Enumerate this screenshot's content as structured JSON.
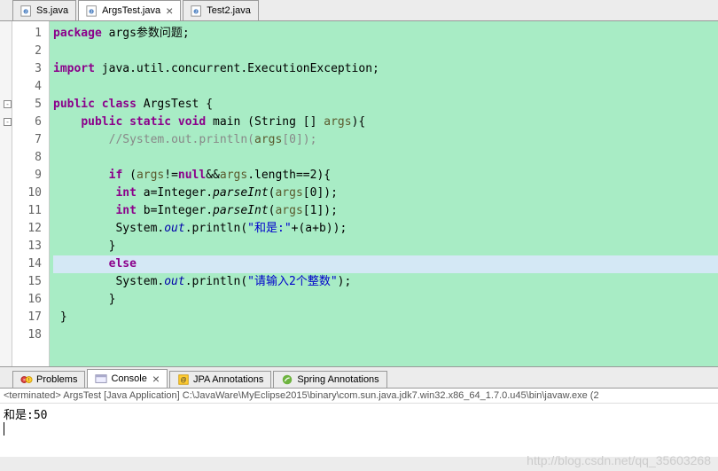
{
  "tabs": [
    {
      "label": "Ss.java",
      "active": false
    },
    {
      "label": "ArgsTest.java",
      "active": true
    },
    {
      "label": "Test2.java",
      "active": false
    }
  ],
  "code": {
    "lines": [
      {
        "n": "1",
        "html": "<span class='kw'>package</span> args参数问题;"
      },
      {
        "n": "2",
        "html": ""
      },
      {
        "n": "3",
        "html": "<span class='kw'>import</span> java.util.concurrent.ExecutionException;",
        "warning": true
      },
      {
        "n": "4",
        "html": ""
      },
      {
        "n": "5",
        "html": "<span class='kw'>public class</span> ArgsTest {",
        "fold": true
      },
      {
        "n": "6",
        "html": "    <span class='kw'>public static void</span> main (String [] <span class='param'>args</span>){",
        "fold": true
      },
      {
        "n": "7",
        "html": "        <span class='comment'>//System.out.println(<span class='param'>args</span>[0]);</span>"
      },
      {
        "n": "8",
        "html": ""
      },
      {
        "n": "9",
        "html": "        <span class='kw'>if</span> (<span class='param'>args</span>!=<span class='kw'>null</span>&&<span class='param'>args</span>.length==2){"
      },
      {
        "n": "10",
        "html": "         <span class='kw'>int</span> a=Integer.<span class='italic'>parseInt</span>(<span class='param'>args</span>[0]);"
      },
      {
        "n": "11",
        "html": "         <span class='kw'>int</span> b=Integer.<span class='italic'>parseInt</span>(<span class='param'>args</span>[1]);"
      },
      {
        "n": "12",
        "html": "         System.<span class='field'>out</span>.println(<span class='str'>\"和是:\"</span>+(a+b));"
      },
      {
        "n": "13",
        "html": "        }"
      },
      {
        "n": "14",
        "html": "        <span class='kw'>else</span>",
        "highlight": true
      },
      {
        "n": "15",
        "html": "         System.<span class='field'>out</span>.println(<span class='str'>\"请输入2个整数\"</span>);"
      },
      {
        "n": "16",
        "html": "        }"
      },
      {
        "n": "17",
        "html": " }"
      },
      {
        "n": "18",
        "html": ""
      }
    ]
  },
  "bottom_tabs": [
    {
      "label": "Problems",
      "active": false
    },
    {
      "label": "Console",
      "active": true,
      "closable": true
    },
    {
      "label": "JPA Annotations",
      "active": false
    },
    {
      "label": "Spring Annotations",
      "active": false
    }
  ],
  "console": {
    "header": "<terminated> ArgsTest [Java Application] C:\\JavaWare\\MyEclipse2015\\binary\\com.sun.java.jdk7.win32.x86_64_1.7.0.u45\\bin\\javaw.exe (2",
    "output": "和是:50"
  },
  "watermark": "http://blog.csdn.net/qq_35603268"
}
